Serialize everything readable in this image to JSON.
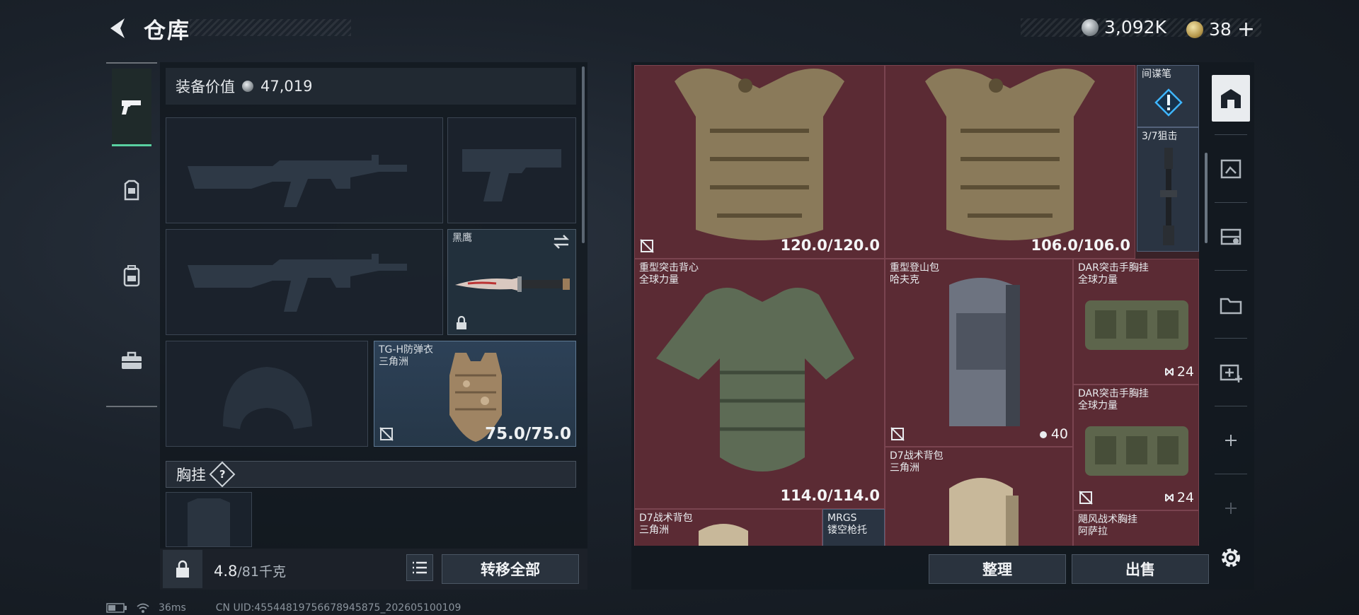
{
  "header": {
    "title": "仓库",
    "currencies": [
      {
        "icon": "silver-coin-icon",
        "value": "3,092K"
      },
      {
        "icon": "gold-coin-icon",
        "value": "38"
      }
    ],
    "add_symbol": "+"
  },
  "left_tabs": [
    {
      "icon": "pistol-icon",
      "active": true
    },
    {
      "icon": "rig-icon",
      "active": false
    },
    {
      "icon": "backpack-icon",
      "active": false
    },
    {
      "icon": "briefcase-icon",
      "active": false
    }
  ],
  "loadout": {
    "value_label": "装备价值",
    "value": "47,019",
    "slots": {
      "knife": {
        "name": "黑鹰"
      },
      "armor": {
        "name": "TG-H防弹衣",
        "sub": "三角洲",
        "durability": "75.0/75.0"
      }
    },
    "chest_rig_label": "胸挂",
    "help": "?"
  },
  "bottom": {
    "weight": "4.8",
    "weight_max": "/81千克",
    "transfer_all": "转移全部"
  },
  "stash": {
    "items": [
      {
        "id": "armor-a",
        "name": "",
        "sub": "",
        "durability": "120.0/120.0"
      },
      {
        "id": "armor-b",
        "name": "",
        "sub": "",
        "durability": "106.0/106.0"
      },
      {
        "id": "spy-pen",
        "name": "间谍笔",
        "sub": ""
      },
      {
        "id": "scope",
        "name": "3/7狙击",
        "sub": ""
      },
      {
        "id": "heavy-vest",
        "name": "重型突击背心",
        "sub": "全球力量",
        "durability": "114.0/114.0"
      },
      {
        "id": "heavy-pack",
        "name": "重型登山包",
        "sub": "哈夫克",
        "count": "40"
      },
      {
        "id": "dar-rig-1",
        "name": "DAR突击手胸挂",
        "sub": "全球力量",
        "count": "24"
      },
      {
        "id": "dar-rig-2",
        "name": "DAR突击手胸挂",
        "sub": "全球力量",
        "count": "24"
      },
      {
        "id": "d7-pack-1",
        "name": "D7战术背包",
        "sub": "三角洲"
      },
      {
        "id": "d7-pack-2",
        "name": "D7战术背包",
        "sub": "三角洲"
      },
      {
        "id": "mrgs",
        "name": "MRGS",
        "sub": "镂空枪托"
      },
      {
        "id": "gale-rig",
        "name": "飓风战术胸挂",
        "sub": "阿萨拉"
      }
    ],
    "sort_btn": "整理",
    "sell_btn": "出售"
  },
  "right_rail": {
    "buttons": [
      "stash-home-icon",
      "frame-icon",
      "map-icon",
      "folder-icon",
      "medkit-icon",
      "add-icon",
      "add-icon",
      "gear-icon"
    ]
  },
  "status": {
    "ping": "36ms",
    "uid": "CN UID:455448197566789458​75_202605100109"
  }
}
